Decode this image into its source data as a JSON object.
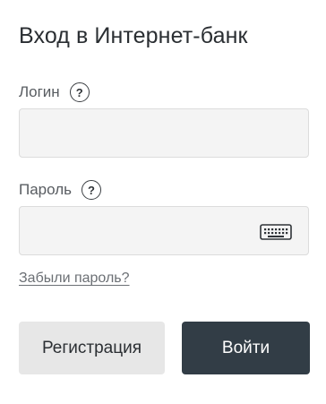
{
  "form": {
    "title": "Вход в Интернет-банк",
    "login": {
      "label": "Логин",
      "value": "",
      "placeholder": ""
    },
    "password": {
      "label": "Пароль",
      "value": "",
      "placeholder": ""
    },
    "help_symbol": "?",
    "forgot_password_label": "Забыли пароль?",
    "register_button_label": "Регистрация",
    "login_button_label": "Войти"
  },
  "colors": {
    "primary_button": "#323d46",
    "secondary_button": "#e7e7e7",
    "input_background": "#f4f4f4"
  },
  "icons": {
    "help": "help-icon",
    "keyboard": "keyboard-icon"
  }
}
